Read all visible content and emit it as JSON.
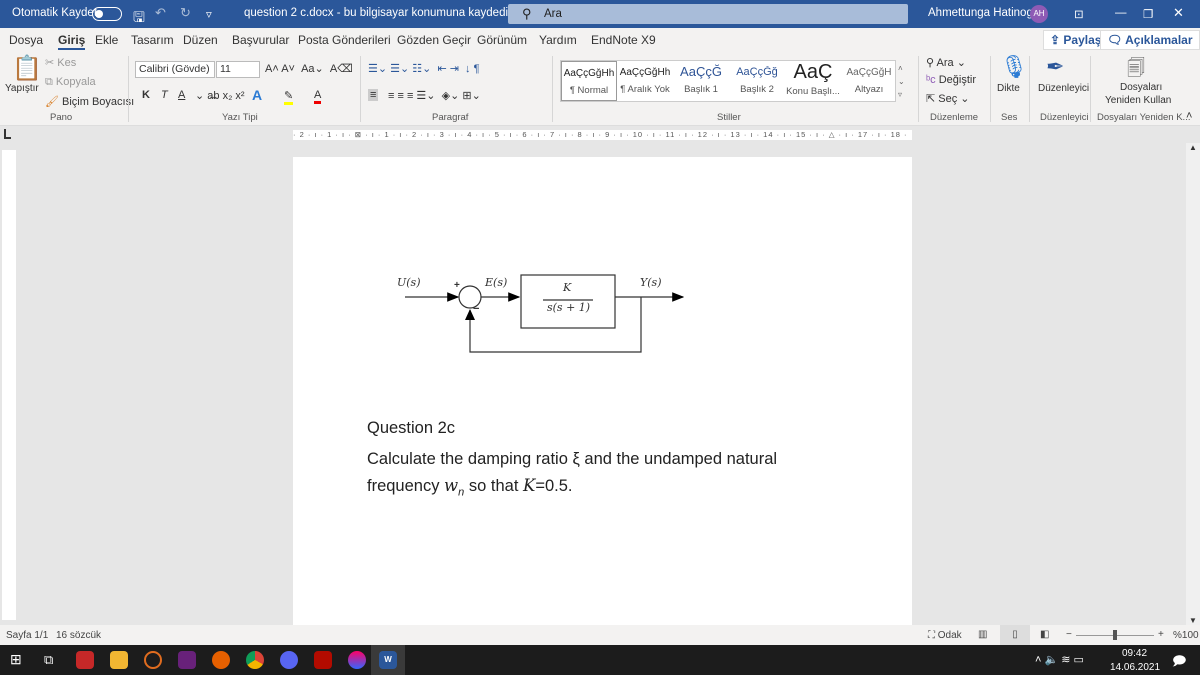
{
  "titlebar": {
    "autosave": "Otomatik Kaydet",
    "doc_title": "question 2 c.docx  -  bu bilgisayar konumuna kaydedildi",
    "search": "Ara",
    "user": "Ahmettunga Hatinoglu",
    "initials": "AH"
  },
  "menu": {
    "tabs": [
      "Dosya",
      "Giriş",
      "Ekle",
      "Tasarım",
      "Düzen",
      "Başvurular",
      "Posta Gönderileri",
      "Gözden Geçir",
      "Görünüm",
      "Yardım",
      "EndNote X9"
    ],
    "share": "Paylaş",
    "comments": "Açıklamalar"
  },
  "ribbon": {
    "clipboard": {
      "paste": "Yapıştır",
      "cut": "Kes",
      "copy": "Kopyala",
      "format_painter": "Biçim Boyacısı",
      "group": "Pano"
    },
    "font": {
      "name": "Calibri (Gövde)",
      "size": "11",
      "group": "Yazı Tipi",
      "bold": "K",
      "italic": "T",
      "underline": "A"
    },
    "paragraph": {
      "group": "Paragraf"
    },
    "styles": {
      "group": "Stiller",
      "items": [
        {
          "preview": "AaÇçĞğHh",
          "label": "¶ Normal"
        },
        {
          "preview": "AaÇçĞğHh",
          "label": "¶ Aralık Yok"
        },
        {
          "preview": "AaÇçĞ",
          "label": "Başlık 1"
        },
        {
          "preview": "AaÇçĞğ",
          "label": "Başlık 2"
        },
        {
          "preview": "AaÇ",
          "label": "Konu Başlı..."
        },
        {
          "preview": "AaÇçĞğH",
          "label": "Altyazı"
        }
      ]
    },
    "editing": {
      "find": "Ara",
      "replace": "Değiştir",
      "select": "Seç",
      "group": "Düzenleme"
    },
    "voice": {
      "dictate": "Dikte",
      "group": "Ses"
    },
    "editor": {
      "label": "Düzenleyici",
      "group": "Düzenleyici"
    },
    "reuse": {
      "label1": "Dosyaları",
      "label2": "Yeniden Kullan",
      "group": "Dosyaları Yeniden K..."
    }
  },
  "ruler": "· 2 · ı · 1 · ı · ⊠ · ı · 1 · ı · 2 · ı · 3 · ı · 4 · ı · 5 · ı · 6 · ı · 7 · ı · 8 · ı · 9 · ı · 10 · ı · 11 · ı · 12 · ı · 13 · ı · 14 · ı · 15 · ı · △ · ı · 17 · ı · 18 ·",
  "document": {
    "diagram": {
      "input": "U(s)",
      "error": "E(s)",
      "output": "Y(s)",
      "numerator": "K",
      "denominator": "s(s + 1)",
      "plus": "+",
      "minus": "−"
    },
    "heading": "Question 2c",
    "line1": "Calculate the damping ratio ξ and the undamped natural",
    "line2_a": "frequency ",
    "line2_w": "w",
    "line2_n": "n",
    "line2_b": " so that ",
    "line2_k": "K",
    "line2_c": "=0.5."
  },
  "status": {
    "page": "Sayfa 1/1",
    "words": "16 sözcük",
    "focus": "Odak",
    "zoom": "%100"
  },
  "taskbar": {
    "time": "09:42",
    "date": "14.06.2021",
    "word_badge": "W"
  }
}
